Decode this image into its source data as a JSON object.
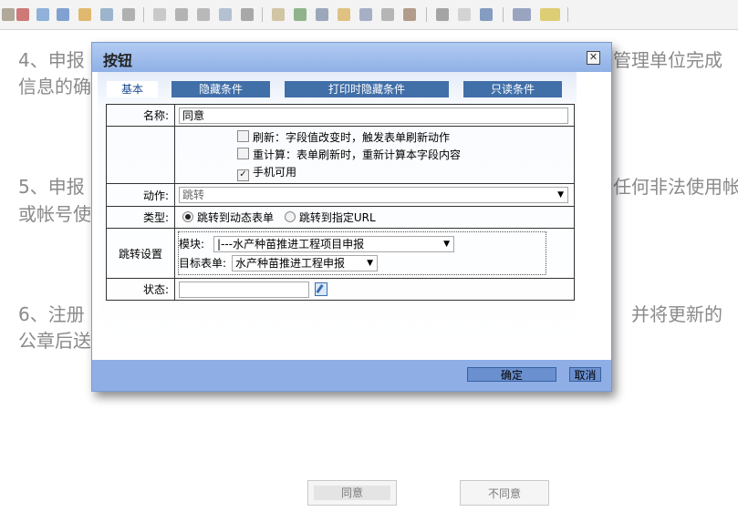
{
  "document": {
    "p4_start": "4、申报",
    "p4_end": "管理单位完成",
    "p4_line2": "信息的确",
    "p5_start": "5、申报",
    "p5_end": "任何非法使用帐",
    "p5_line2": "或帐号使",
    "p6_start": "6、注册",
    "p6_end": "并将更新的",
    "p6_line2": "公章后送"
  },
  "page_buttons": {
    "agree": "同意",
    "disagree": "不同意"
  },
  "dialog": {
    "title": "按钮",
    "close_glyph": "✕",
    "tabs": [
      {
        "label": "基本",
        "active": true
      },
      {
        "label": "隐藏条件",
        "active": false
      },
      {
        "label": "打印时隐藏条件",
        "active": false
      },
      {
        "label": "只读条件",
        "active": false
      }
    ],
    "form": {
      "name_label": "名称:",
      "name_value": "同意",
      "options": [
        {
          "label": "刷新：字段值改变时，触发表单刷新动作",
          "checked": false,
          "check_glyph": ""
        },
        {
          "label": "重计算：表单刷新时，重新计算本字段内容",
          "checked": false,
          "check_glyph": ""
        },
        {
          "label": "手机可用",
          "checked": true,
          "check_glyph": "✓"
        }
      ],
      "action_label": "动作:",
      "action_value": "跳转",
      "type_label": "类型:",
      "type_options": [
        {
          "label": "跳转到动态表单",
          "selected": true
        },
        {
          "label": "跳转到指定URL",
          "selected": false
        }
      ],
      "jump_label": "跳转设置",
      "module_label": "模块:",
      "module_value": "|---水产种苗推进工程项目申报",
      "target_label": "目标表单:",
      "target_value": "水产种苗推进工程申报",
      "status_label": "状态:",
      "status_value": ""
    },
    "ok_label": "确定",
    "cancel_label": "取消"
  },
  "colors": {
    "dialog_header": "#9fbdee",
    "tab_inactive": "#416fa8",
    "footer": "#8faee6",
    "doc_text": "#8a8a8a"
  }
}
